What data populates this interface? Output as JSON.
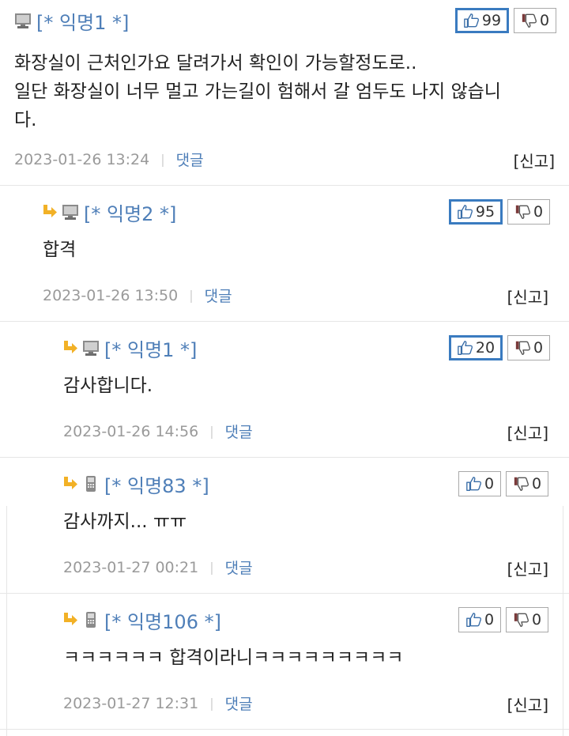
{
  "comments": [
    {
      "author": "[* 익명1 *]",
      "device": "pc-icon",
      "likes": "99",
      "dislikes": "0",
      "likes_highlighted": true,
      "body_lines": [
        "화장실이 근처인가요 달려가서 확인이 가능할정도로..",
        "일단 화장실이 너무 멀고 가는길이 험해서 갈 엄두도 나지 않습니",
        "다."
      ],
      "timestamp": "2023-01-26 13:24",
      "reply_label": "댓글",
      "report_label": "[신고]"
    },
    {
      "author": "[* 익명2 *]",
      "device": "pc-icon",
      "likes": "95",
      "dislikes": "0",
      "likes_highlighted": true,
      "body_lines": [
        "합격"
      ],
      "timestamp": "2023-01-26 13:50",
      "reply_label": "댓글",
      "report_label": "[신고]"
    },
    {
      "author": "[* 익명1 *]",
      "device": "pc-icon",
      "likes": "20",
      "dislikes": "0",
      "likes_highlighted": true,
      "body_lines": [
        "감사합니다."
      ],
      "timestamp": "2023-01-26 14:56",
      "reply_label": "댓글",
      "report_label": "[신고]"
    },
    {
      "author": "[* 익명83 *]",
      "device": "mobile-icon",
      "likes": "0",
      "dislikes": "0",
      "likes_highlighted": false,
      "body_lines": [
        "감사까지... ㅠㅠ"
      ],
      "timestamp": "2023-01-27 00:21",
      "reply_label": "댓글",
      "report_label": "[신고]"
    },
    {
      "author": "[* 익명106 *]",
      "device": "mobile-icon",
      "likes": "0",
      "dislikes": "0",
      "likes_highlighted": false,
      "body_lines": [
        "ㅋㅋㅋㅋㅋㅋ 합격이라니ㅋㅋㅋㅋㅋㅋㅋㅋㅋ"
      ],
      "timestamp": "2023-01-27 12:31",
      "reply_label": "댓글",
      "report_label": "[신고]"
    }
  ],
  "colors": {
    "author": "#4f7fb8",
    "highlight_border": "#3a7bc0",
    "arrow": "#f2b126",
    "meta": "#9a9a9a"
  }
}
